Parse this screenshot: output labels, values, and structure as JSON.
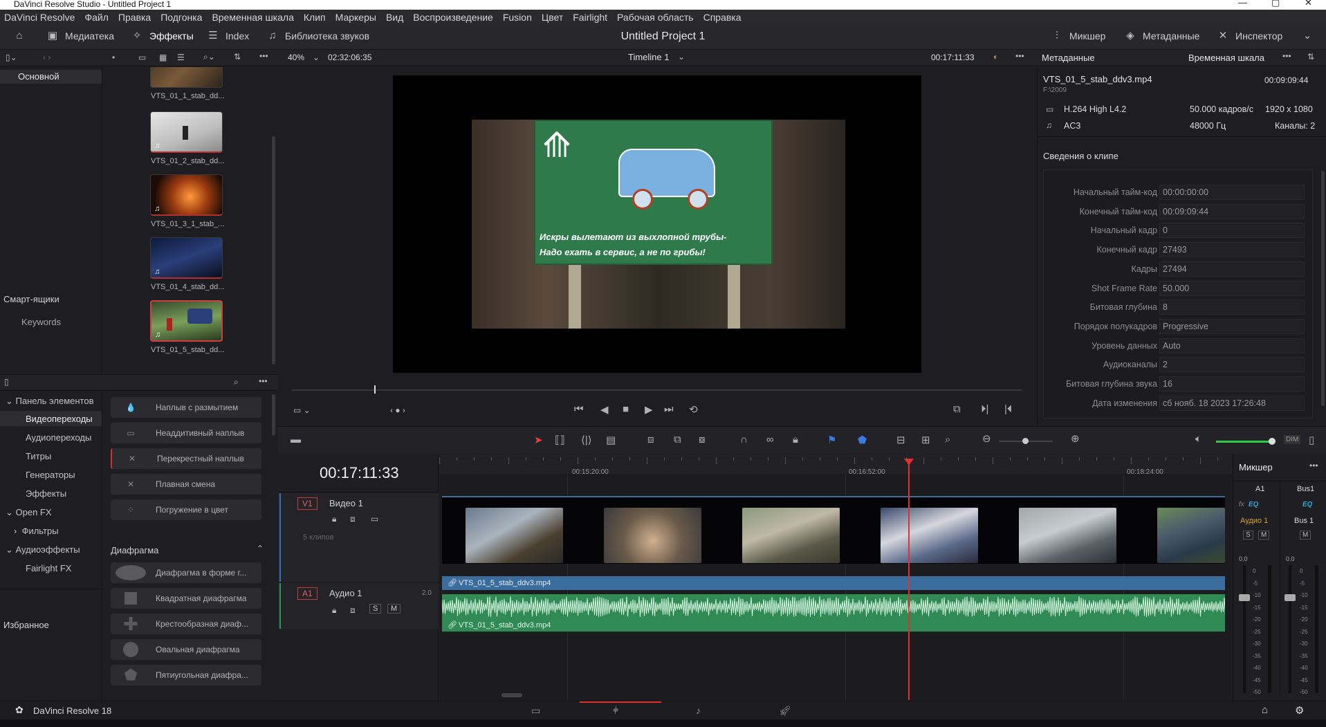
{
  "window": {
    "title": "DaVinci Resolve Studio - Untitled Project 1"
  },
  "menu": [
    "DaVinci Resolve",
    "Файл",
    "Правка",
    "Подгонка",
    "Временная шкала",
    "Клип",
    "Маркеры",
    "Вид",
    "Воспроизведение",
    "Fusion",
    "Цвет",
    "Fairlight",
    "Рабочая область",
    "Справка"
  ],
  "toolbar": {
    "media": "Медиатека",
    "effects": "Эффекты",
    "index": "Index",
    "sound_library": "Библиотека звуков",
    "project_title": "Untitled Project 1",
    "mixer": "Микшер",
    "metadata": "Метаданные",
    "inspector": "Инспектор"
  },
  "viewer": {
    "zoom": "40%",
    "timecode_left": "02:32:06:35",
    "timeline_name": "Timeline 1",
    "timecode_right": "00:17:11:33"
  },
  "media_pool": {
    "bin": "Основной",
    "smart_bins": "Смарт-ящики",
    "keywords": "Keywords",
    "clips": [
      "VTS_01_1_stab_dd...",
      "VTS_01_2_stab_dd...",
      "VTS_01_3_1_stab_...",
      "VTS_01_4_stab_dd...",
      "VTS_01_5_stab_dd..."
    ]
  },
  "effects_panel": {
    "tree": {
      "toolbox": "Панель элементов",
      "video_transitions": "Видеопереходы",
      "audio_transitions": "Аудиопереходы",
      "titles": "Титры",
      "generators": "Генераторы",
      "effects": "Эффекты",
      "open_fx": "Open FX",
      "filters": "Фильтры",
      "audio_fx": "Аудиоэффекты",
      "fairlight_fx": "Fairlight FX",
      "favorites": "Избранное"
    },
    "dissolve_items": [
      "Наплыв с размытием",
      "Неаддитивный наплыв",
      "Перекрестный наплыв",
      "Плавная смена",
      "Погружение в цвет"
    ],
    "iris_header": "Диафрагма",
    "iris_items": [
      "Диафрагма в форме г...",
      "Квадратная диафрагма",
      "Крестообразная диаф...",
      "Овальная диафрагма",
      "Пятиугольная диафра..."
    ]
  },
  "metadata_panel": {
    "tab_metadata": "Метаданные",
    "tab_timeline": "Временная шкала",
    "filename": "VTS_01_5_stab_ddv3.mp4",
    "path": "F:\\2009",
    "duration": "00:09:09:44",
    "codec": "H.264 High L4.2",
    "fps": "50.000 кадров/с",
    "resolution": "1920 x 1080",
    "audio_codec": "AC3",
    "sample_rate": "48000 Гц",
    "channels": "Каналы: 2",
    "section": "Сведения о клипе",
    "rows": [
      {
        "k": "Начальный тайм-код",
        "v": "00:00:00:00"
      },
      {
        "k": "Конечный тайм-код",
        "v": "00:09:09:44"
      },
      {
        "k": "Начальный кадр",
        "v": "0"
      },
      {
        "k": "Конечный кадр",
        "v": "27493"
      },
      {
        "k": "Кадры",
        "v": "27494"
      },
      {
        "k": "Shot Frame Rate",
        "v": "50.000"
      },
      {
        "k": "Битовая глубина",
        "v": "8"
      },
      {
        "k": "Порядок полукадров",
        "v": "Progressive"
      },
      {
        "k": "Уровень данных",
        "v": "Auto"
      },
      {
        "k": "Аудиоканалы",
        "v": "2"
      },
      {
        "k": "Битовая глубина звука",
        "v": "16"
      },
      {
        "k": "Дата изменения",
        "v": "сб нояб. 18 2023 17:26:48"
      }
    ]
  },
  "timeline": {
    "timecode": "00:17:11:33",
    "ruler": [
      "00:15:20:00",
      "00:16:52:00",
      "00:18:24:00"
    ],
    "video_track": {
      "id": "V1",
      "name": "Видео 1",
      "clips_count": "5 клипов",
      "clip_name": "VTS_01_5_stab_ddv3.mp4"
    },
    "audio_track": {
      "id": "A1",
      "name": "Аудио 1",
      "level": "2.0",
      "clip_name": "VTS_01_5_stab_ddv3.mp4",
      "solo": "S",
      "mute": "M"
    }
  },
  "mixer": {
    "title": "Микшер",
    "ch1": "A1",
    "ch2": "Bus1",
    "fx": "fx",
    "eq": "EQ",
    "ch1_name": "Аудио 1",
    "ch2_name": "Bus 1",
    "solo": "S",
    "mute": "M",
    "level1": "0.0",
    "level2": "0.0",
    "dim": "DIM",
    "scale": [
      "0",
      "-5",
      "-10",
      "-15",
      "-20",
      "-25",
      "-30",
      "-35",
      "-40",
      "-45",
      "-50"
    ]
  },
  "status": {
    "app": "DaVinci Resolve 18"
  },
  "sign_text": {
    "line1": "Искры вылетают из выхлопной трубы-",
    "line2": "Надо ехать в сервис, а не по грибы!"
  }
}
